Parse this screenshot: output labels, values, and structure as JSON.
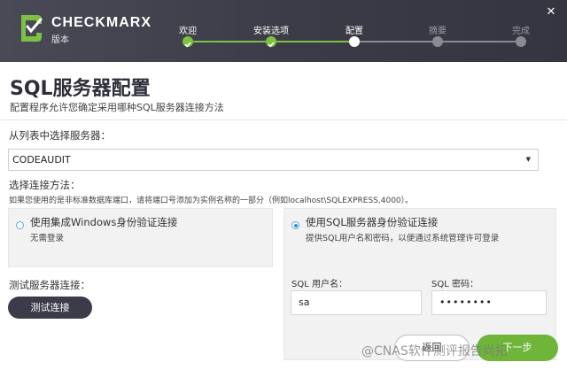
{
  "header": {
    "brand": "CHECKMARX",
    "brand_sub": "版本",
    "close": "✕",
    "steps": [
      {
        "label": "欢迎",
        "state": "done"
      },
      {
        "label": "安装选项",
        "state": "done"
      },
      {
        "label": "配置",
        "state": "current"
      },
      {
        "label": "摘要",
        "state": "pending"
      },
      {
        "label": "完成",
        "state": "pending"
      }
    ]
  },
  "page": {
    "title": "SQL服务器配置",
    "subtitle": "配置程序允许您确定采用哪种SQL服务器连接方法"
  },
  "server": {
    "label": "从列表中选择服务器：",
    "selected": "CODEAUDIT"
  },
  "method": {
    "label": "选择连接方法：",
    "hint": "如果您使用的是非标准数据库端口，请将端口号添加为实例名称的一部分（例如localhost\\SQLEXPRESS,4000）。",
    "windows": {
      "title": "使用集成Windows身份验证连接",
      "desc": "无需登录",
      "selected": false
    },
    "sql": {
      "title": "使用SQL服务器身份验证连接",
      "desc": "提供SQL用户名和密码，以便通过系统管理许可登录",
      "selected": true,
      "username_label": "SQL 用户名：",
      "username_value": "sa",
      "password_label": "SQL 密码：",
      "password_value": "••••••••"
    }
  },
  "test": {
    "label": "测试服务器连接：",
    "button": "测试连接"
  },
  "nav": {
    "back": "返回",
    "next": "下一步"
  },
  "watermark": "@CNAS软件测评报告尚拓",
  "colors": {
    "header_bg": "#3b3b47",
    "step_done": "#7cc142",
    "step_current": "#ffffff",
    "step_pending": "#8a8a93",
    "radio_accent": "#2c8fce",
    "primary_button": "#3b3b4a",
    "next_button": "#6fb53a"
  }
}
